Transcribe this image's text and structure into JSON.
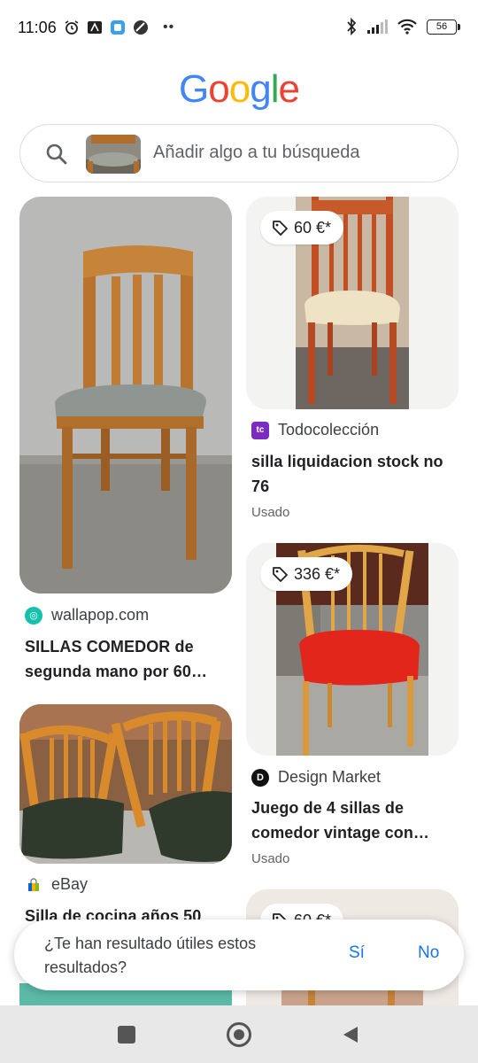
{
  "status_bar": {
    "time": "11:06",
    "battery": "56"
  },
  "logo": {
    "letters": [
      "G",
      "o",
      "o",
      "g",
      "l",
      "e"
    ],
    "colors": [
      "#4285F4",
      "#EA4335",
      "#FBBC05",
      "#4285F4",
      "#34A853",
      "#EA4335"
    ]
  },
  "search": {
    "placeholder": "Añadir algo a tu búsqueda"
  },
  "results": [
    {
      "source": "wallapop.com",
      "title_line1": "SILLAS COMEDOR de",
      "title_line2": "segunda mano por 60…",
      "favicon": "wallapop-icon"
    },
    {
      "price": "60 €*",
      "source": "Todocolección",
      "title_line1": "silla liquidacion stock no",
      "title_line2": "76",
      "condition": "Usado",
      "favicon": "todocoleccion-icon"
    },
    {
      "source": "eBay",
      "title_line1": "Silla de cocina años 50",
      "favicon": "ebay-icon"
    },
    {
      "price": "336 €*",
      "source": "Design Market",
      "title_line1": "Juego de 4 sillas de",
      "title_line2": "comedor vintage con…",
      "condition": "Usado",
      "favicon": "designmarket-icon"
    },
    {
      "price": "60 €*"
    }
  ],
  "feedback": {
    "question": "¿Te han resultado útiles estos resultados?",
    "yes": "Sí",
    "no": "No"
  },
  "colors": {
    "accent": "#1a73e8"
  }
}
